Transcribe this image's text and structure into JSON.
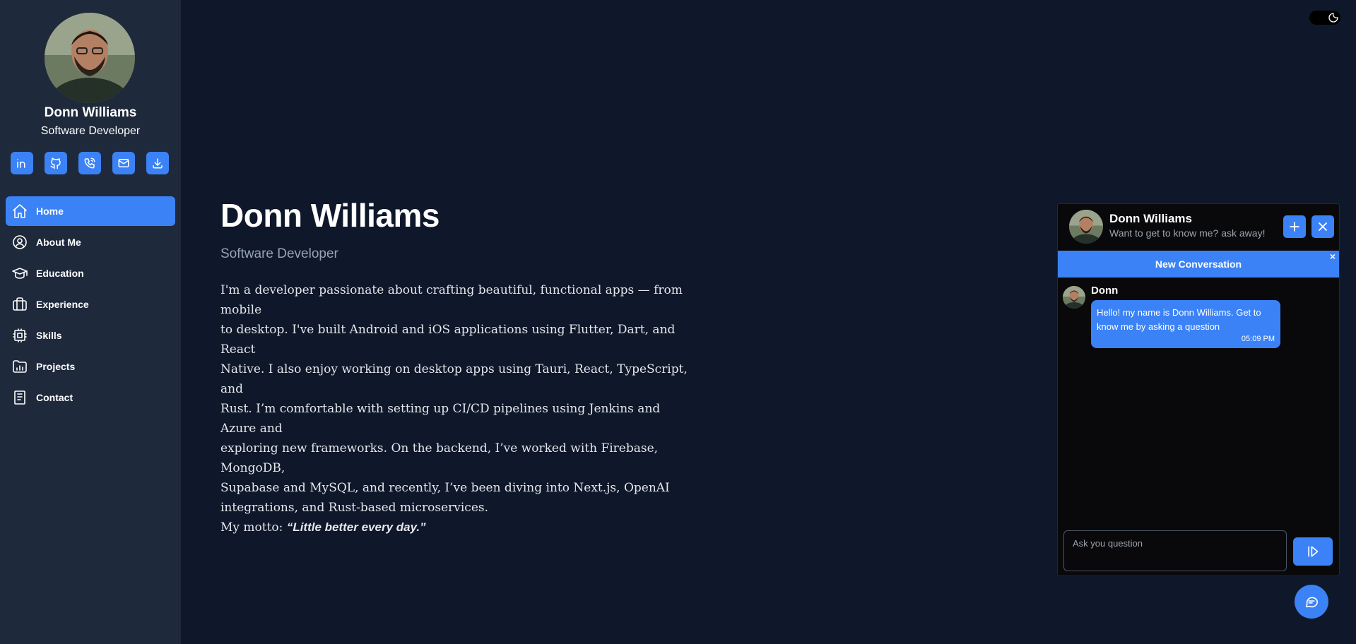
{
  "colors": {
    "accent": "#3b82f6",
    "sidebar_bg": "#1e293b",
    "page_bg": "#0f172a",
    "chat_bg": "#09090b",
    "muted_text": "#94a3b8"
  },
  "sidebar": {
    "name": "Donn Williams",
    "role": "Software Developer",
    "social": [
      {
        "icon": "linkedin-icon"
      },
      {
        "icon": "github-icon"
      },
      {
        "icon": "phone-icon"
      },
      {
        "icon": "mail-icon"
      },
      {
        "icon": "download-icon"
      }
    ],
    "nav": [
      {
        "label": "Home",
        "icon": "home-icon",
        "active": true
      },
      {
        "label": "About Me",
        "icon": "user-circle-icon",
        "active": false
      },
      {
        "label": "Education",
        "icon": "graduation-cap-icon",
        "active": false
      },
      {
        "label": "Experience",
        "icon": "briefcase-icon",
        "active": false
      },
      {
        "label": "Skills",
        "icon": "chip-icon",
        "active": false
      },
      {
        "label": "Projects",
        "icon": "folder-chart-icon",
        "active": false
      },
      {
        "label": "Contact",
        "icon": "document-icon",
        "active": false
      }
    ]
  },
  "theme_toggle": {
    "icon": "moon-icon"
  },
  "main": {
    "title": "Donn Williams",
    "subtitle": "Software Developer",
    "bio_lines": [
      "I'm a developer passionate about crafting beautiful, functional apps — from mobile",
      "to desktop. I've built Android and iOS applications using Flutter, Dart, and React",
      "Native. I also enjoy working on desktop apps using Tauri, React, TypeScript, and",
      "Rust. I’m comfortable with setting up CI/CD pipelines using Jenkins and Azure and",
      "exploring new frameworks. On the backend, I’ve worked with Firebase, MongoDB,",
      "Supabase and MySQL, and recently, I’ve been diving into Next.js, OpenAI",
      "integrations, and Rust-based microservices."
    ],
    "motto_label": "My motto: ",
    "motto_quote": "“Little better every day.”"
  },
  "chat": {
    "header_name": "Donn Williams",
    "header_tagline": "Want to get to know me? ask away!",
    "new_button_icon": "plus-icon",
    "close_button_icon": "close-icon",
    "banner_text": "New Conversation",
    "banner_close": "×",
    "messages": [
      {
        "sender": "Donn",
        "text": "Hello! my name is Donn Williams. Get to know me by asking a question",
        "time": "05:09 PM"
      }
    ],
    "input_placeholder": "Ask you question",
    "send_icon": "send-icon"
  },
  "fab": {
    "icon": "chat-bubble-icon"
  }
}
